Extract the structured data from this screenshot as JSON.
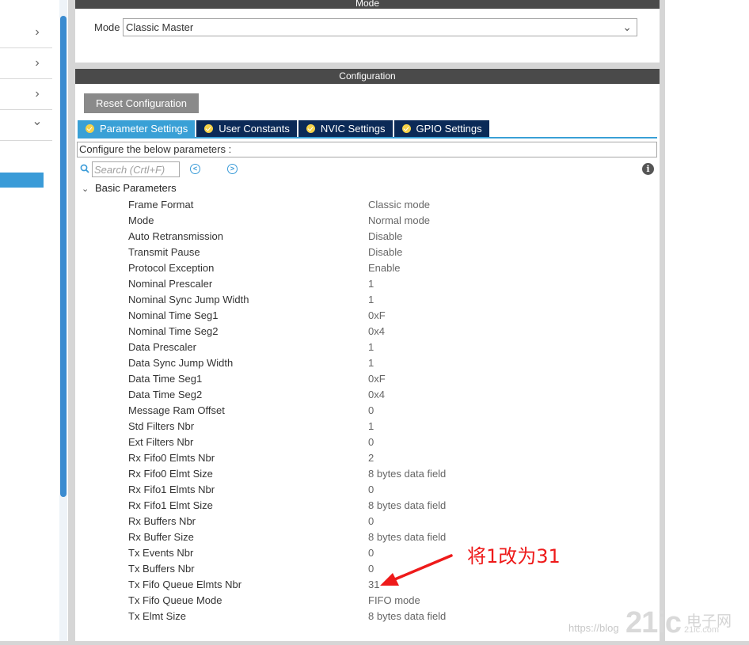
{
  "sidebar": {
    "rows": [
      {
        "icon": "chevron-right-icon",
        "glyph": "›"
      },
      {
        "icon": "chevron-right-icon",
        "glyph": "›"
      },
      {
        "icon": "chevron-right-icon",
        "glyph": "›"
      },
      {
        "icon": "chevron-down-icon",
        "glyph": "⌄"
      }
    ]
  },
  "mode_panel": {
    "title": "Mode",
    "mode_label": "Mode",
    "mode_value": "Classic Master"
  },
  "config_panel": {
    "title": "Configuration",
    "reset_label": "Reset Configuration",
    "tabs": [
      {
        "label": "Parameter Settings",
        "active": true
      },
      {
        "label": "User Constants",
        "active": false
      },
      {
        "label": "NVIC Settings",
        "active": false
      },
      {
        "label": "GPIO Settings",
        "active": false
      }
    ],
    "description": "Configure the below parameters :",
    "search_placeholder": "Search (Crtl+F)",
    "group_title": "Basic Parameters",
    "parameters": [
      {
        "name": "Frame Format",
        "value": "Classic mode"
      },
      {
        "name": "Mode",
        "value": "Normal mode"
      },
      {
        "name": "Auto Retransmission",
        "value": "Disable"
      },
      {
        "name": "Transmit Pause",
        "value": "Disable"
      },
      {
        "name": "Protocol Exception",
        "value": "Enable"
      },
      {
        "name": "Nominal Prescaler",
        "value": "1"
      },
      {
        "name": "Nominal Sync Jump Width",
        "value": "1"
      },
      {
        "name": "Nominal Time Seg1",
        "value": "0xF"
      },
      {
        "name": "Nominal Time Seg2",
        "value": "0x4"
      },
      {
        "name": "Data Prescaler",
        "value": "1"
      },
      {
        "name": "Data Sync Jump Width",
        "value": "1"
      },
      {
        "name": "Data Time Seg1",
        "value": "0xF"
      },
      {
        "name": "Data Time Seg2",
        "value": "0x4"
      },
      {
        "name": "Message Ram Offset",
        "value": "0"
      },
      {
        "name": "Std Filters Nbr",
        "value": "1"
      },
      {
        "name": "Ext Filters Nbr",
        "value": "0"
      },
      {
        "name": "Rx Fifo0 Elmts Nbr",
        "value": "2"
      },
      {
        "name": "Rx Fifo0 Elmt Size",
        "value": "8 bytes data field"
      },
      {
        "name": "Rx Fifo1 Elmts Nbr",
        "value": "0"
      },
      {
        "name": "Rx Fifo1 Elmt Size",
        "value": "8 bytes data field"
      },
      {
        "name": "Rx Buffers Nbr",
        "value": "0"
      },
      {
        "name": "Rx Buffer Size",
        "value": "8 bytes data field"
      },
      {
        "name": "Tx Events Nbr",
        "value": "0"
      },
      {
        "name": "Tx Buffers Nbr",
        "value": "0"
      },
      {
        "name": "Tx Fifo Queue Elmts Nbr",
        "value": "31"
      },
      {
        "name": "Tx Fifo Queue Mode",
        "value": "FIFO mode"
      },
      {
        "name": "Tx Elmt Size",
        "value": "8 bytes data field"
      }
    ]
  },
  "annotation": {
    "text": "将1改为31",
    "color": "#ee1a1a"
  },
  "watermark": {
    "url_text": "https://blog",
    "logo_text": "21ic",
    "cn_text": "电子网",
    "cn_sub": "21ic.com"
  },
  "colors": {
    "tab_active": "#39a0d6",
    "tab_inactive": "#0b2a57",
    "header_bar": "#4a4a4a",
    "reset_button": "#8a8a8a"
  }
}
